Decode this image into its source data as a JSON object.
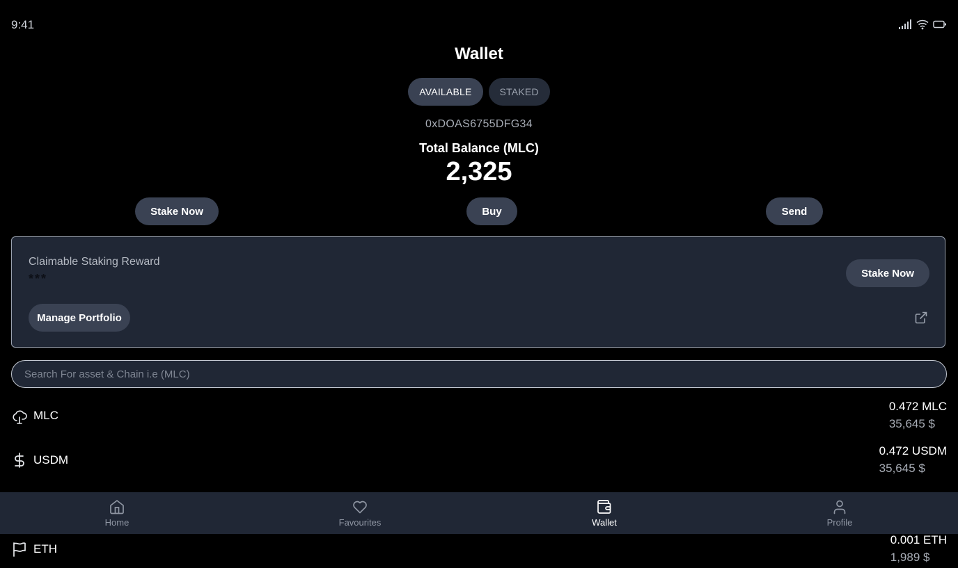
{
  "status_bar": {
    "time": "9:41"
  },
  "header": {
    "title": "Wallet"
  },
  "tabs": [
    {
      "label": "AVAILABLE",
      "active": true
    },
    {
      "label": "STAKED",
      "active": false
    }
  ],
  "wallet": {
    "address": "0xDOAS6755DFG34",
    "balance_label": "Total Balance (MLC)",
    "balance_value": "2,325"
  },
  "actions": {
    "stake_label": "Stake Now",
    "buy_label": "Buy",
    "send_label": "Send"
  },
  "reward_card": {
    "label": "Claimable Staking Reward",
    "masked_value": "***",
    "stake_label": "Stake Now",
    "manage_label": "Manage Portfolio"
  },
  "search": {
    "placeholder": "Search For asset & Chain i.e (MLC)"
  },
  "assets": [
    {
      "name": "MLC",
      "icon": "cloud-icon",
      "amount": "0.472 MLC",
      "usd": "35,645 $"
    },
    {
      "name": "USDM",
      "icon": "dollar-icon",
      "amount": "0.472 USDM",
      "usd": "35,645 $"
    },
    {
      "name": "ETH",
      "icon": "flag-icon",
      "amount": "0.001 ETH",
      "usd": "1,989 $"
    }
  ],
  "bottom_nav": [
    {
      "label": "Home",
      "icon": "home-icon",
      "active": false
    },
    {
      "label": "Favourites",
      "icon": "heart-icon",
      "active": false
    },
    {
      "label": "Wallet",
      "icon": "wallet-icon",
      "active": true
    },
    {
      "label": "Profile",
      "icon": "user-icon",
      "active": false
    }
  ],
  "colors": {
    "background": "#000000",
    "card": "#202735",
    "button": "#3a4253",
    "muted_text": "#a7acb5"
  }
}
